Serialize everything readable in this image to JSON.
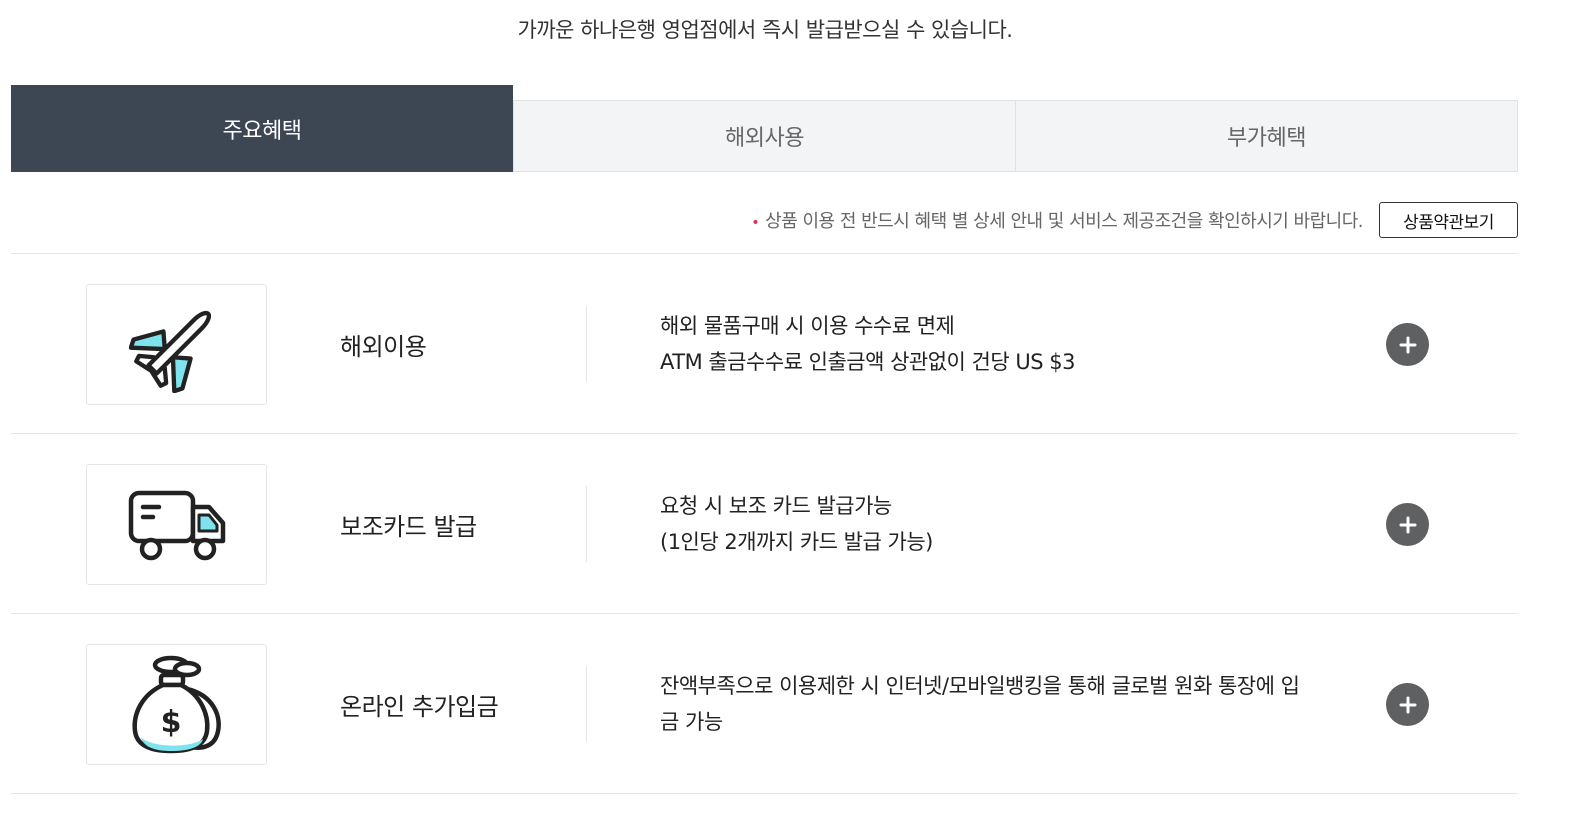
{
  "intro_text": "가까운 하나은행 영업점에서 즉시 발급받으실 수 있습니다.",
  "tabs": [
    {
      "label": "주요혜택",
      "active": true
    },
    {
      "label": "해외사용",
      "active": false
    },
    {
      "label": "부가혜택",
      "active": false
    }
  ],
  "notice": {
    "bullet": "•",
    "text": "상품 이용 전 반드시 혜택 별 상세 안내 및 서비스 제공조건을 확인하시기 바랍니다.",
    "button_label": "상품약관보기"
  },
  "benefits": [
    {
      "icon": "airplane-icon",
      "title": "해외이용",
      "lines": [
        "해외 물품구매 시 이용 수수료 면제",
        "ATM 출금수수료 인출금액 상관없이 건당 US $3"
      ]
    },
    {
      "icon": "delivery-truck-icon",
      "title": "보조카드 발급",
      "lines": [
        "요청 시 보조 카드 발급가능",
        "(1인당 2개까지 카드 발급 가능)"
      ]
    },
    {
      "icon": "money-bag-icon",
      "title": "온라인 추가입금",
      "lines": [
        "잔액부족으로 이용제한 시 인터넷/모바일뱅킹을 통해 글로벌 원화 통장에 입",
        "금 가능"
      ]
    }
  ],
  "colors": {
    "active_tab_bg": "#3d4653",
    "inactive_tab_bg": "#f3f4f6",
    "accent_bullet": "#e0305c",
    "icon_accent": "#7ee3ec",
    "plus_button": "#5e6062"
  }
}
